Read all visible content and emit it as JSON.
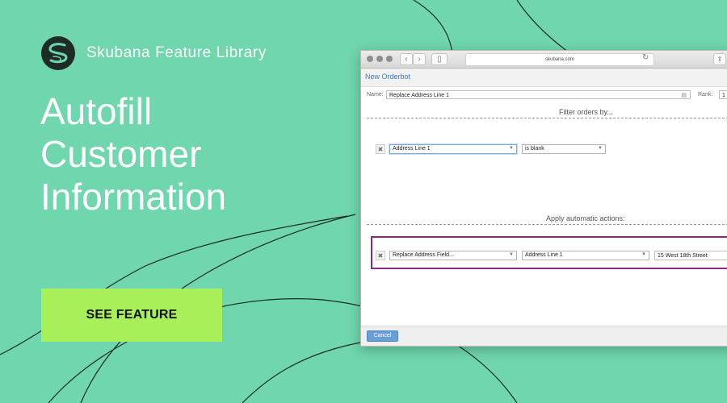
{
  "brand": {
    "name": "Skubana Feature Library"
  },
  "hero": {
    "lines": [
      "Autofill",
      "Customer",
      "Information"
    ]
  },
  "cta": {
    "label": "SEE FEATURE"
  },
  "colors": {
    "background": "#6fd6ad",
    "cta": "#a7f05a",
    "highlight": "#8a2a86",
    "link": "#3b78c3"
  },
  "browser": {
    "url": "skubana.com",
    "page_title": "New Orderbot",
    "name_label": "Name:",
    "name_value": "Replace Address Line 1",
    "rank_label": "Rank:",
    "rank_value": "1",
    "filter_title": "Filter orders by...",
    "filter": {
      "field": "Address Line 1",
      "operator": "is blank"
    },
    "actions_title": "Apply automatic actions:",
    "action": {
      "type": "Replace Address Field...",
      "field": "Address Line 1",
      "value": "15 West 18th Street"
    },
    "cancel_label": "Cancel"
  }
}
